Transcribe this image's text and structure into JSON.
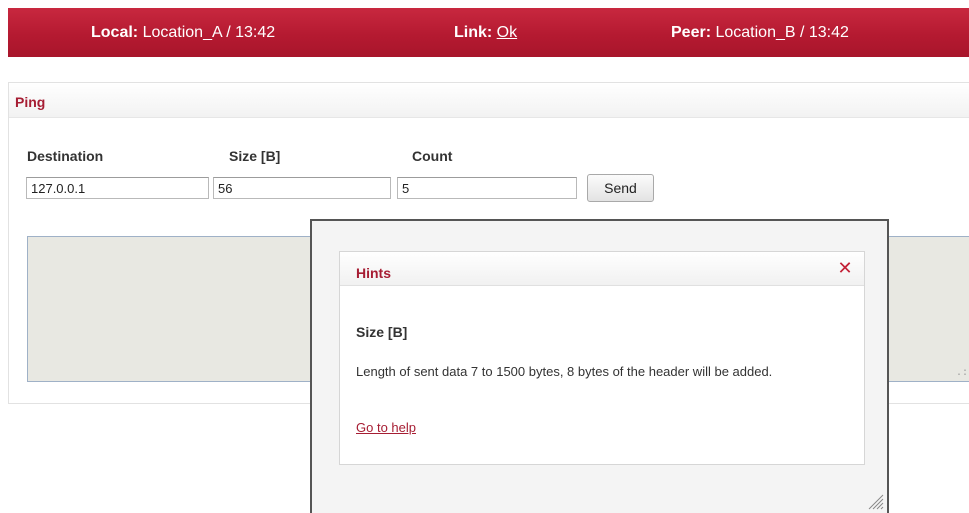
{
  "status_bar": {
    "local_label": "Local:",
    "local_value": "Location_A / 13:42",
    "link_label": "Link:",
    "link_value": "Ok",
    "peer_label": "Peer:",
    "peer_value": "Location_B / 13:42"
  },
  "ping": {
    "title": "Ping",
    "destination_label": "Destination",
    "destination_value": "127.0.0.1",
    "size_label": "Size [B]",
    "size_value": "56",
    "count_label": "Count",
    "count_value": "5",
    "send_label": "Send",
    "output": ""
  },
  "hints": {
    "title": "Hints",
    "close_symbol": "✕",
    "heading": "Size [B]",
    "text": "Length of sent data 7 to 1500 bytes, 8 bytes of the header will be added.",
    "help_link": "Go to help"
  },
  "colors": {
    "brand": "#b51a31",
    "title_text": "#a61d33"
  }
}
